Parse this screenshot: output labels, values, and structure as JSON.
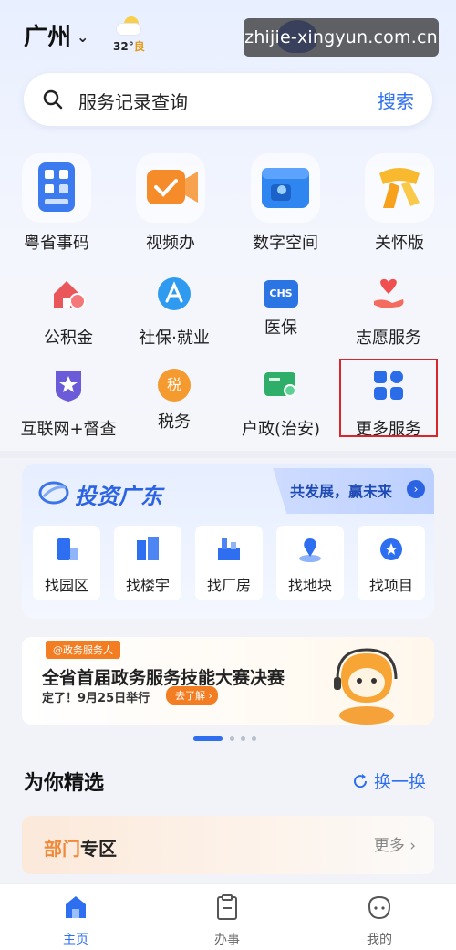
{
  "header": {
    "city": "广州",
    "weather_temp": "32°",
    "weather_aqi": "良",
    "watermark": "zhijie-xingyun.com.cn"
  },
  "search": {
    "placeholder": "服务记录查询",
    "button": "搜索"
  },
  "featured_services": [
    {
      "label": "粤省事码",
      "icon": "qr-code-icon"
    },
    {
      "label": "视频办",
      "icon": "video-office-icon"
    },
    {
      "label": "数字空间",
      "icon": "digital-space-icon"
    },
    {
      "label": "关怀版",
      "icon": "care-scarf-icon"
    }
  ],
  "services_row1": [
    {
      "label": "公积金",
      "icon": "housing-fund-icon"
    },
    {
      "label": "社保·就业",
      "icon": "social-security-icon"
    },
    {
      "label": "医保",
      "icon": "medical-insurance-icon"
    },
    {
      "label": "志愿服务",
      "icon": "volunteer-heart-icon"
    }
  ],
  "services_row2": [
    {
      "label": "互联网+督查",
      "icon": "inspection-star-icon"
    },
    {
      "label": "税务",
      "icon": "tax-icon"
    },
    {
      "label": "户政(治安)",
      "icon": "household-card-icon"
    },
    {
      "label": "更多服务",
      "icon": "more-grid-icon"
    }
  ],
  "icon_texts": {
    "tax": "税",
    "chs": "CHS"
  },
  "invest": {
    "title": "投资广东",
    "slogan": "共发展，赢未来",
    "arrow": "›",
    "items": [
      {
        "label": "找园区",
        "icon": "park-icon"
      },
      {
        "label": "找楼宇",
        "icon": "building-icon"
      },
      {
        "label": "找厂房",
        "icon": "factory-icon"
      },
      {
        "label": "找地块",
        "icon": "land-pin-icon"
      },
      {
        "label": "找项目",
        "icon": "project-icon"
      }
    ]
  },
  "banner": {
    "tag": "@政务服务人",
    "headline": "全省首届政务服务技能大赛决赛",
    "sub": "定了！9月25日举行",
    "more": "去了解 ›"
  },
  "carousel": {
    "active_index": 0,
    "count": 4
  },
  "picks": {
    "title": "为你精选",
    "refresh": "换一换"
  },
  "dept": {
    "name_highlight": "部门",
    "name_rest": "专区",
    "more": "更多 ›"
  },
  "tabbar": [
    {
      "label": "主页",
      "active": true,
      "icon": "home-icon"
    },
    {
      "label": "办事",
      "active": false,
      "icon": "clipboard-icon"
    },
    {
      "label": "我的",
      "active": false,
      "icon": "profile-mascot-icon"
    }
  ],
  "colors": {
    "accent": "#2d6ff0",
    "highlight_border": "#d8262b",
    "orange": "#f27d22"
  }
}
